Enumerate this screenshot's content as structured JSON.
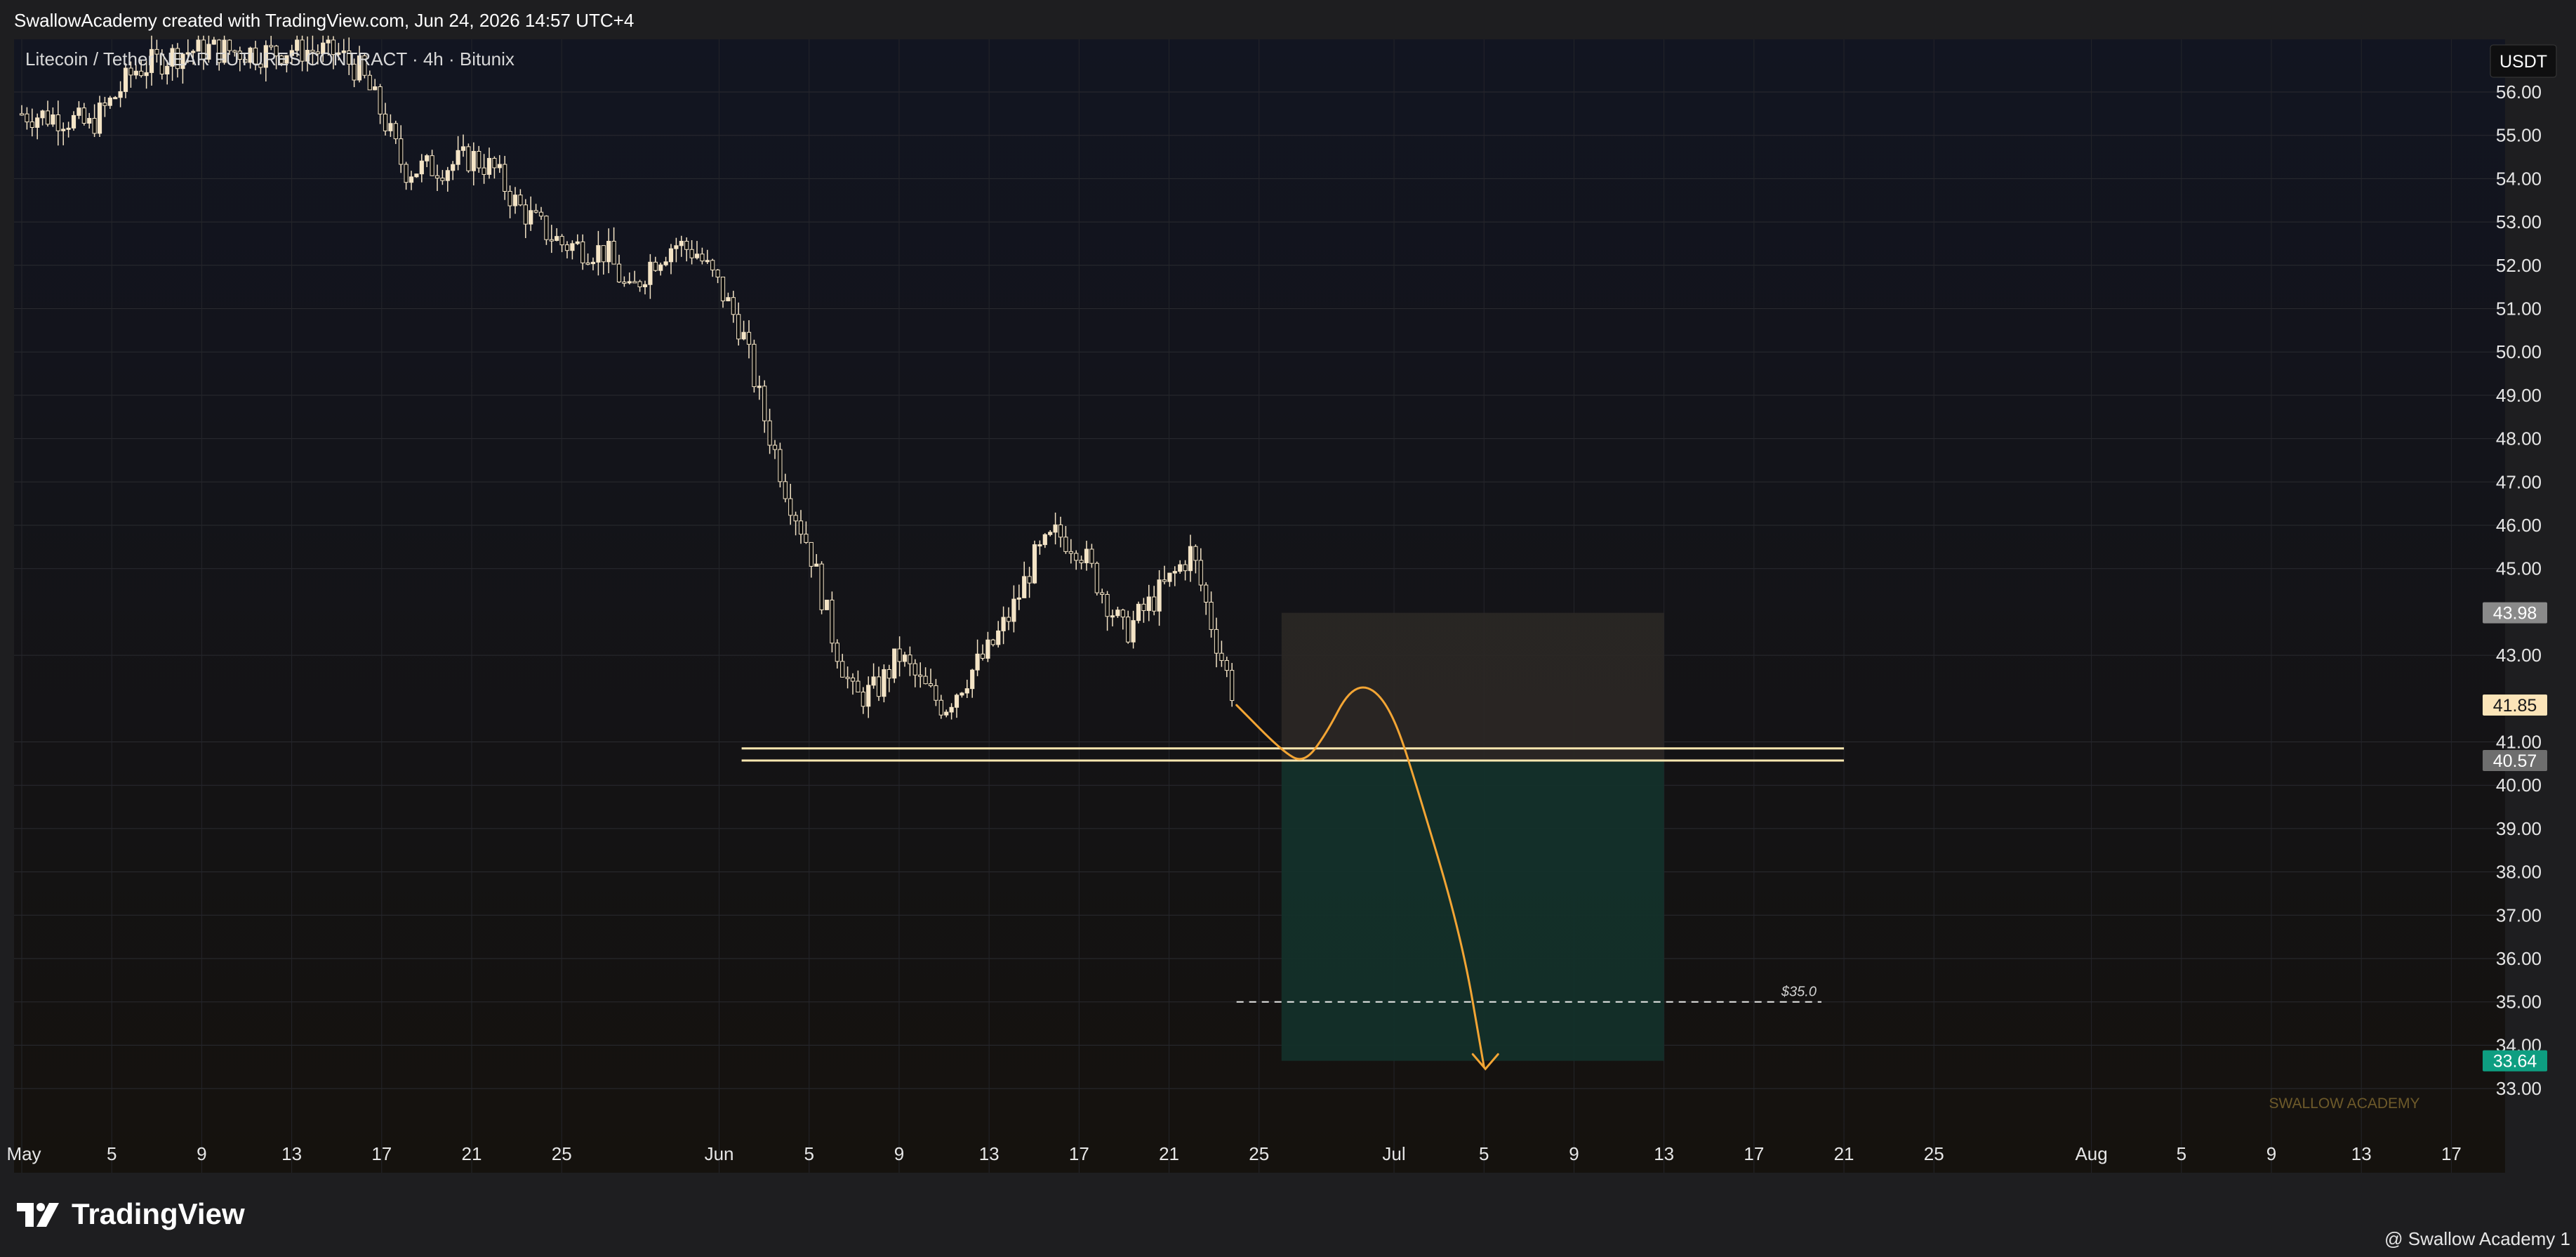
{
  "header": {
    "credit": "SwallowAcademy created with TradingView.com, Jun 24, 2026 14:57 UTC+4"
  },
  "footer": {
    "brand": "TradingView",
    "attribution": "@ Swallow Academy 1"
  },
  "chart_data": {
    "type": "candlestick",
    "symbol_label": "Litecoin / Tether  NEAR FUTURES CONTRACT · 4h · Bitunix",
    "currency": "USDT",
    "watermark": "SWALLOW ACADEMY",
    "grid": true,
    "ylim": [
      32.0,
      57.0
    ],
    "y_ticks": [
      "56.00",
      "55.00",
      "54.00",
      "53.00",
      "52.00",
      "51.00",
      "50.00",
      "49.00",
      "48.00",
      "47.00",
      "46.00",
      "45.00",
      "43.00",
      "41.00",
      "40.00",
      "39.00",
      "38.00",
      "37.00",
      "36.00",
      "35.00",
      "34.00",
      "33.00"
    ],
    "x_ticks": [
      "May",
      "5",
      "9",
      "13",
      "17",
      "21",
      "25",
      "Jun",
      "5",
      "9",
      "13",
      "17",
      "21",
      "25",
      "Jul",
      "5",
      "9",
      "13",
      "17",
      "21",
      "25",
      "Aug",
      "5",
      "9",
      "13",
      "17"
    ],
    "price_path": [
      [
        "2026-05-01",
        55.5
      ],
      [
        "2026-05-03",
        55.4
      ],
      [
        "2026-05-04",
        55.2
      ],
      [
        "2026-05-05",
        55.8
      ],
      [
        "2026-05-06",
        56.5
      ],
      [
        "2026-05-08",
        56.9
      ],
      [
        "2026-05-09",
        57.0
      ],
      [
        "2026-05-12",
        56.9
      ],
      [
        "2026-05-13",
        57.0
      ],
      [
        "2026-05-15",
        56.9
      ],
      [
        "2026-05-16",
        56.5
      ],
      [
        "2026-05-17",
        55.5
      ],
      [
        "2026-05-18",
        54.2
      ],
      [
        "2026-05-20",
        54.3
      ],
      [
        "2026-05-21",
        54.5
      ],
      [
        "2026-05-22",
        54.2
      ],
      [
        "2026-05-23",
        53.4
      ],
      [
        "2026-05-24",
        52.9
      ],
      [
        "2026-05-25",
        52.5
      ],
      [
        "2026-05-27",
        52.3
      ],
      [
        "2026-05-28",
        51.3
      ],
      [
        "2026-05-29",
        52.1
      ],
      [
        "2026-05-30",
        52.5
      ],
      [
        "2026-05-31",
        52.3
      ],
      [
        "2026-06-01",
        51.5
      ],
      [
        "2026-06-02",
        50.5
      ],
      [
        "2026-06-03",
        48.5
      ],
      [
        "2026-06-04",
        46.8
      ],
      [
        "2026-06-05",
        45.5
      ],
      [
        "2026-06-06",
        43.5
      ],
      [
        "2026-06-07",
        42.0
      ],
      [
        "2026-06-08",
        42.2
      ],
      [
        "2026-06-09",
        43.0
      ],
      [
        "2026-06-10",
        42.3
      ],
      [
        "2026-06-11",
        41.8
      ],
      [
        "2026-06-12",
        42.5
      ],
      [
        "2026-06-13",
        43.1
      ],
      [
        "2026-06-14",
        44.0
      ],
      [
        "2026-06-15",
        45.2
      ],
      [
        "2026-06-16",
        45.8
      ],
      [
        "2026-06-17",
        45.5
      ],
      [
        "2026-06-18",
        44.5
      ],
      [
        "2026-06-19",
        43.5
      ],
      [
        "2026-06-20",
        44.1
      ],
      [
        "2026-06-21",
        44.7
      ],
      [
        "2026-06-22",
        45.4
      ],
      [
        "2026-06-23",
        43.5
      ],
      [
        "2026-06-24",
        41.85
      ]
    ],
    "support_zone": [
      40.57,
      40.85
    ],
    "target_level": {
      "value": 35.0,
      "label": "$35.0"
    },
    "trade_box": {
      "from": "2026-06-26",
      "to": "2026-07-13",
      "top": 43.98,
      "mid": 40.57,
      "bottom": 33.64
    },
    "projection_path": [
      [
        "2026-06-24",
        41.85
      ],
      [
        "2026-06-26",
        40.8
      ],
      [
        "2026-06-27",
        40.5
      ],
      [
        "2026-06-28",
        41.2
      ],
      [
        "2026-06-29",
        42.2
      ],
      [
        "2026-06-30",
        42.3
      ],
      [
        "2026-07-01",
        41.6
      ],
      [
        "2026-07-02",
        40.0
      ],
      [
        "2026-07-04",
        36.5
      ],
      [
        "2026-07-05",
        33.5
      ]
    ],
    "price_labels": [
      {
        "value": "43.98",
        "color": "#8a8a8a"
      },
      {
        "value": "41.85",
        "color": "#fbe4b8"
      },
      {
        "value": "40.57",
        "color": "#6e6e6e"
      },
      {
        "value": "33.64",
        "color": "#0e9e81"
      }
    ],
    "colors": {
      "candle_up": "#f4e4c6",
      "candle_down": "#0c0c0c",
      "projection": "#f3a534",
      "support_line": "#fde7b0",
      "profit_zone": "#13302a",
      "loss_zone": "#2b2825"
    }
  }
}
